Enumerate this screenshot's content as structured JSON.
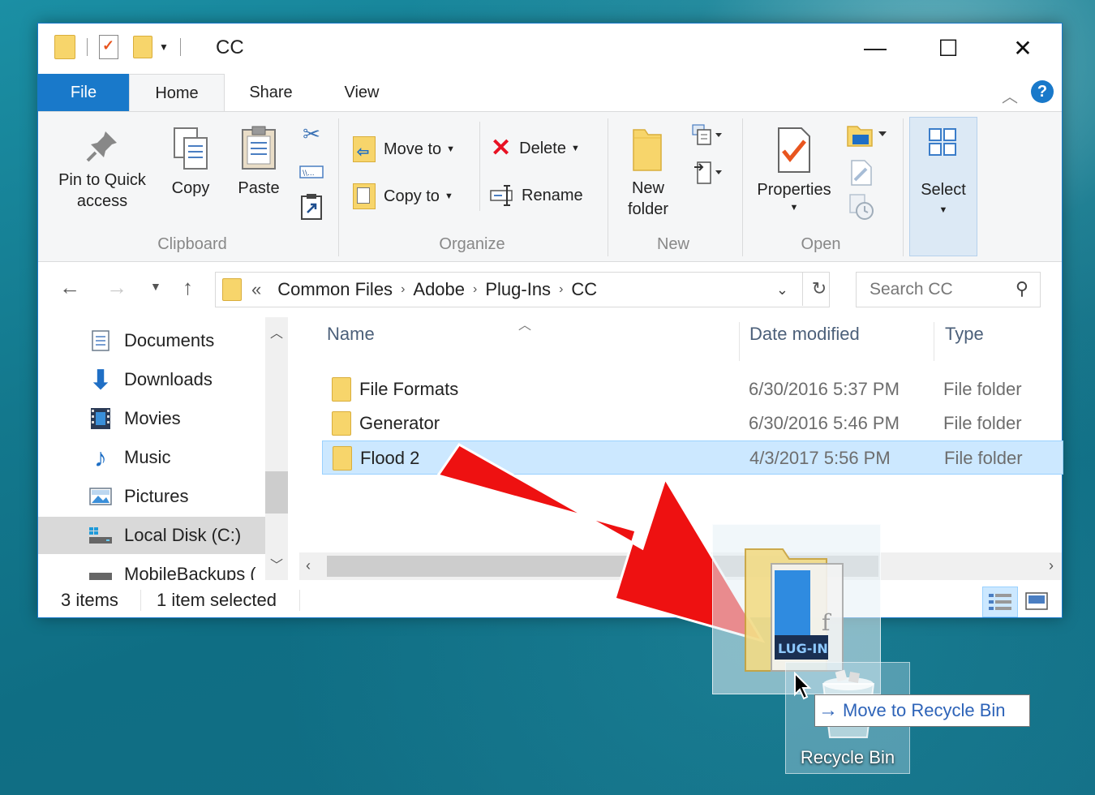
{
  "window": {
    "title": "CC",
    "controls": {
      "minimize": "—",
      "maximize": "☐",
      "close": "✕"
    }
  },
  "ribbon_tabs": [
    {
      "label": "File"
    },
    {
      "label": "Home"
    },
    {
      "label": "Share"
    },
    {
      "label": "View"
    }
  ],
  "ribbon": {
    "clipboard": {
      "pin_label_1": "Pin to Quick",
      "pin_label_2": "access",
      "copy": "Copy",
      "paste": "Paste",
      "group": "Clipboard"
    },
    "organize": {
      "move_to": "Move to",
      "copy_to": "Copy to",
      "delete": "Delete",
      "rename": "Rename",
      "group": "Organize"
    },
    "new": {
      "new_folder_1": "New",
      "new_folder_2": "folder",
      "group": "New"
    },
    "open": {
      "properties": "Properties",
      "group": "Open"
    },
    "select": {
      "label": "Select"
    }
  },
  "address": {
    "overflow": "«",
    "segments": [
      "Common Files",
      "Adobe",
      "Plug-Ins",
      "CC"
    ],
    "search_placeholder": "Search CC"
  },
  "nav_pane": [
    {
      "label": "Documents",
      "icon": "documents-icon"
    },
    {
      "label": "Downloads",
      "icon": "downloads-icon"
    },
    {
      "label": "Movies",
      "icon": "movies-icon"
    },
    {
      "label": "Music",
      "icon": "music-icon"
    },
    {
      "label": "Pictures",
      "icon": "pictures-icon"
    },
    {
      "label": "Local Disk (C:)",
      "icon": "local-disk-icon",
      "active": true
    },
    {
      "label": "MobileBackups (",
      "icon": "drive-icon"
    }
  ],
  "columns": {
    "name": "Name",
    "date": "Date modified",
    "type": "Type"
  },
  "files": [
    {
      "name": "File Formats",
      "date": "6/30/2016 5:37 PM",
      "type": "File folder"
    },
    {
      "name": "Generator",
      "date": "6/30/2016 5:46 PM",
      "type": "File folder"
    },
    {
      "name": "Flood 2",
      "date": "4/3/2017 5:56 PM",
      "type": "File folder",
      "selected": true
    }
  ],
  "status": {
    "items": "3 items",
    "selected": "1 item selected"
  },
  "drag": {
    "ghost_text": "LUG-IN",
    "tooltip": "Move to Recycle Bin",
    "recycle_label": "Recycle Bin"
  },
  "colors": {
    "accent": "#1979ca",
    "selection": "#cce8ff",
    "arrow": "#ee1111",
    "folder": "#f7d56b"
  }
}
